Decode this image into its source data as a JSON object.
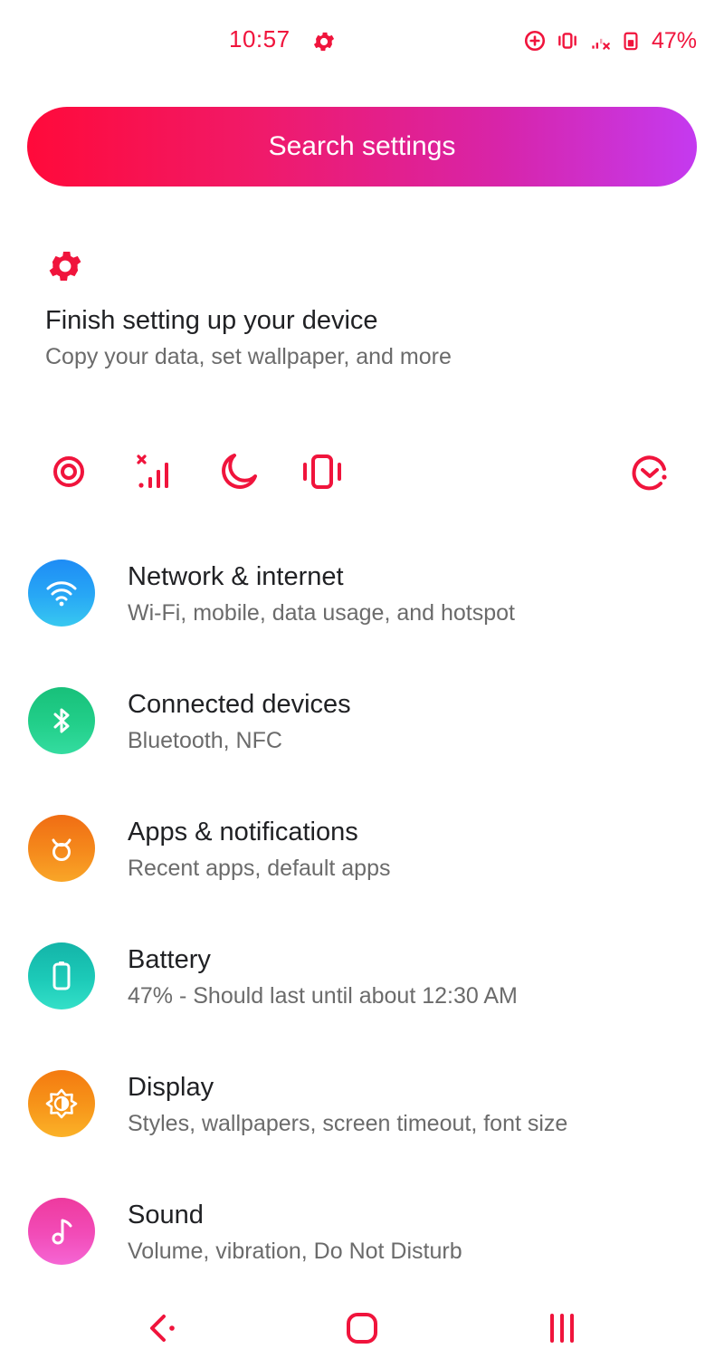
{
  "status_bar": {
    "time": "10:57",
    "battery_percent": "47%",
    "accent_color": "#f0143c",
    "icons": [
      "settings-gear-icon",
      "data-saver-icon",
      "vibrate-icon",
      "no-signal-icon",
      "battery-icon"
    ]
  },
  "search": {
    "label": "Search settings",
    "gradient": [
      "#ff0a3a",
      "#c43af0"
    ]
  },
  "suggestion": {
    "icon": "gear-icon",
    "title": "Finish setting up your device",
    "subtitle": "Copy your data, set wallpaper, and more"
  },
  "conditions": [
    {
      "name": "hotspot-icon"
    },
    {
      "name": "no-signal-icon"
    },
    {
      "name": "do-not-disturb-moon-icon"
    },
    {
      "name": "vibrate-icon"
    },
    {
      "name": "expand-chevron-icon"
    }
  ],
  "settings": [
    {
      "icon": "wifi-icon",
      "title": "Network & internet",
      "subtitle": "Wi-Fi, mobile, data usage, and hotspot"
    },
    {
      "icon": "bluetooth-icon",
      "title": "Connected devices",
      "subtitle": "Bluetooth, NFC"
    },
    {
      "icon": "apps-icon",
      "title": "Apps & notifications",
      "subtitle": "Recent apps, default apps"
    },
    {
      "icon": "battery-icon",
      "title": "Battery",
      "subtitle": "47% - Should last until about 12:30 AM"
    },
    {
      "icon": "display-brightness-icon",
      "title": "Display",
      "subtitle": "Styles, wallpapers, screen timeout, font size"
    },
    {
      "icon": "music-note-icon",
      "title": "Sound",
      "subtitle": "Volume, vibration, Do Not Disturb"
    }
  ],
  "nav_bar": {
    "buttons": [
      "back-icon",
      "home-icon",
      "recents-icon"
    ],
    "color": "#f0143c"
  }
}
